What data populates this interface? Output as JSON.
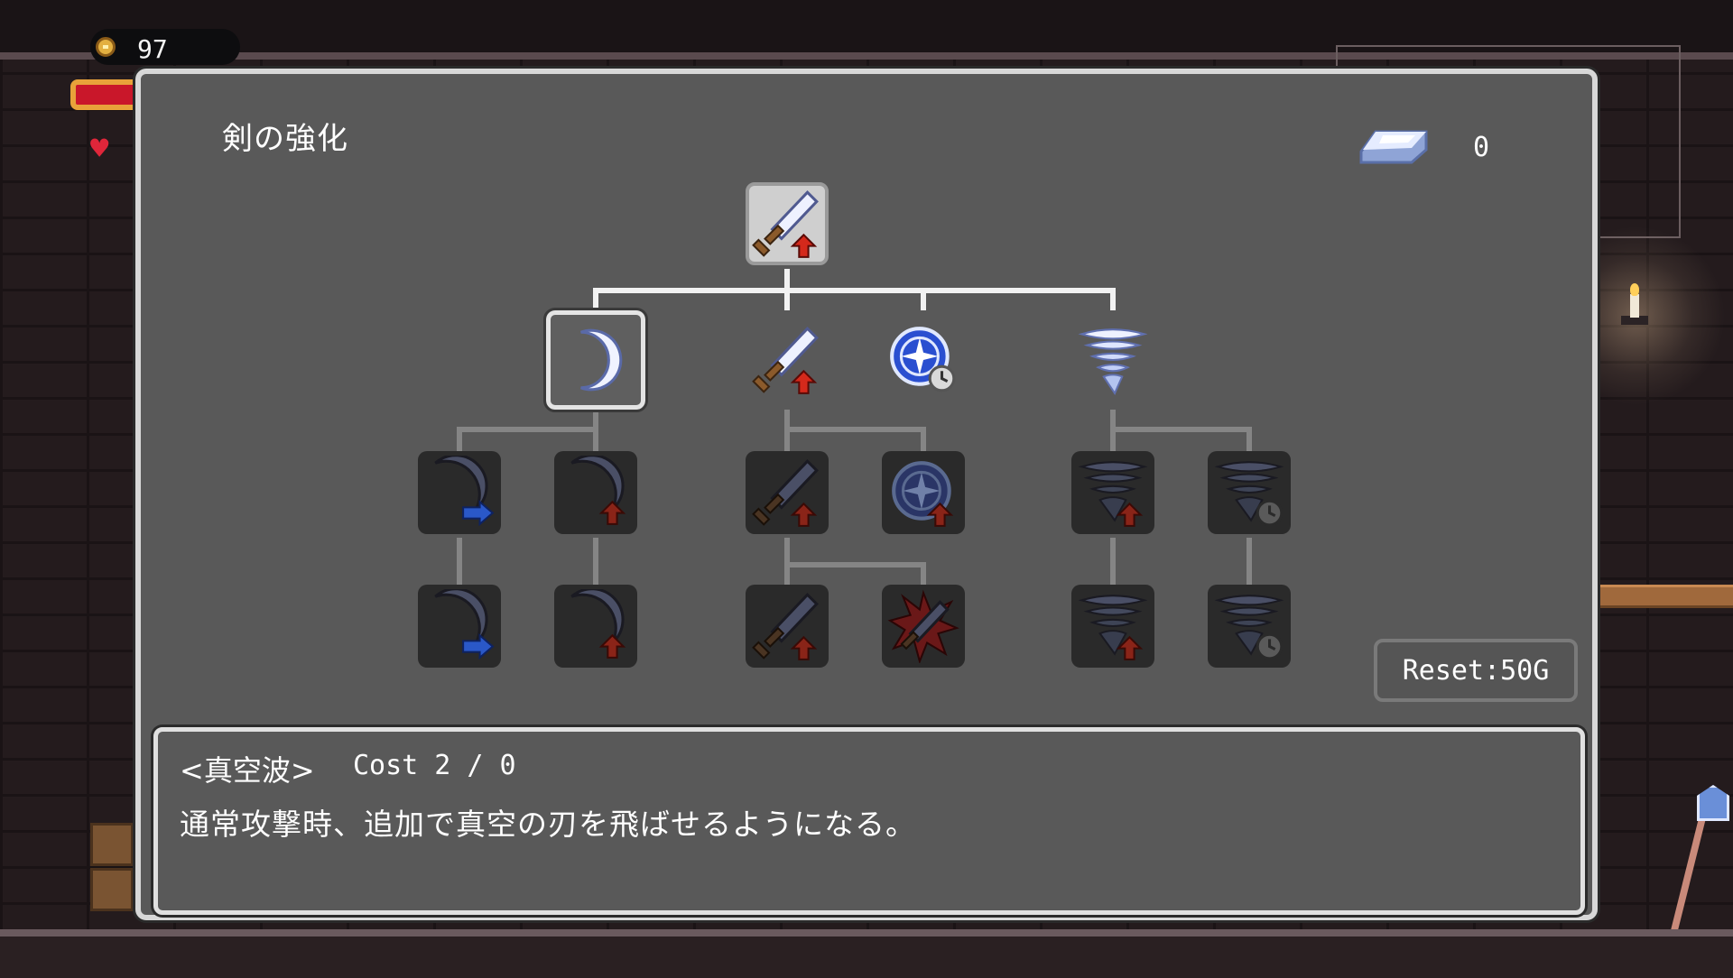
{
  "hud": {
    "gold_value": "97",
    "coin_icon": "coin-icon",
    "heart_icon": "heart-icon"
  },
  "panel": {
    "title": "剣の強化",
    "ingot_icon": "silver-ingot-icon",
    "ingot_count": "0",
    "reset_label": "Reset:50G"
  },
  "skill_tree": {
    "root": {
      "icon": "sword-upgrade-icon",
      "state": "unlocked"
    },
    "tier1": [
      {
        "icon": "crescent-wave-icon",
        "state": "selected"
      },
      {
        "icon": "sword-upgrade-icon",
        "state": "unlocked"
      },
      {
        "icon": "crosshair-timer-icon",
        "state": "unlocked"
      },
      {
        "icon": "tornado-icon",
        "state": "unlocked"
      }
    ],
    "tier2": [
      {
        "icon": "crescent-dash-icon",
        "state": "locked"
      },
      {
        "icon": "crescent-upgrade-icon",
        "state": "locked"
      },
      {
        "icon": "sword-upgrade-icon",
        "state": "locked"
      },
      {
        "icon": "crosshair-upgrade-icon",
        "state": "locked"
      },
      {
        "icon": "tornado-upgrade-icon",
        "state": "locked"
      },
      {
        "icon": "tornado-timer-icon",
        "state": "locked"
      }
    ],
    "tier3": [
      {
        "icon": "crescent-dash-icon",
        "state": "locked"
      },
      {
        "icon": "crescent-upgrade-icon",
        "state": "locked"
      },
      {
        "icon": "sword-upgrade-icon",
        "state": "locked"
      },
      {
        "icon": "burst-sword-icon",
        "state": "locked"
      },
      {
        "icon": "tornado-upgrade-icon",
        "state": "locked"
      },
      {
        "icon": "tornado-timer-icon",
        "state": "locked"
      }
    ]
  },
  "description": {
    "name": "<真空波>",
    "cost": "Cost 2 / 0",
    "text": "通常攻撃時、追加で真空の刃を飛ばせるようになる。"
  },
  "colors": {
    "panel_bg": "#595959",
    "panel_border": "#d8d8d8",
    "locked_node_bg": "#2a2a2a",
    "upgrade_arrow": "#d4291b",
    "dash_arrow": "#2a58c8"
  }
}
